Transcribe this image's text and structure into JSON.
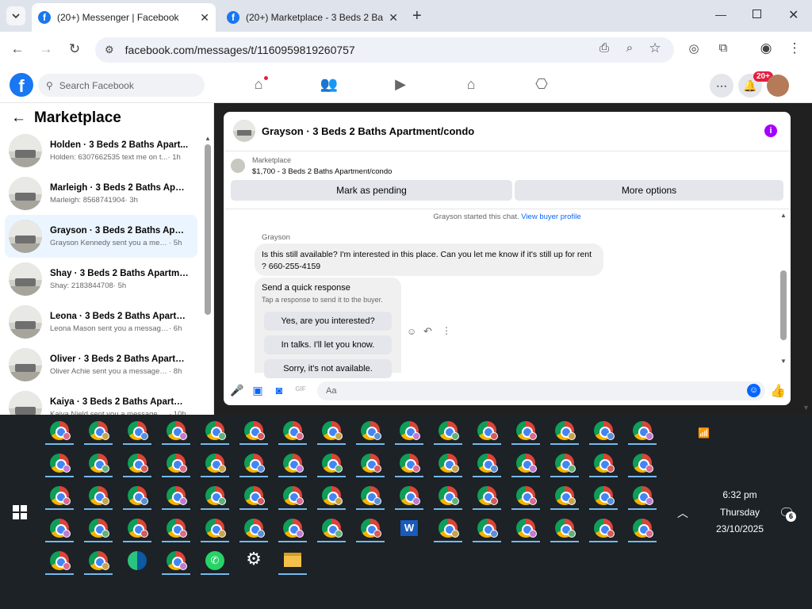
{
  "tabs": [
    {
      "title": "(20+) Messenger | Facebook"
    },
    {
      "title": "(20+) Marketplace - 3 Beds 2 Ba"
    }
  ],
  "address": {
    "url": "facebook.com/messages/t/1160959819260757"
  },
  "fb": {
    "search_placeholder": "Search Facebook",
    "notif_badge": "20+"
  },
  "sidebar": {
    "title": "Marketplace",
    "items": [
      {
        "name": "Holden · 3 Beds 2 Baths Apart...",
        "preview": "Holden: 6307662535 text me on t...",
        "time": " · 1h"
      },
      {
        "name": "Marleigh · 3 Beds 2 Baths Apart...",
        "preview": "Marleigh: 8568741904",
        "time": " · 3h"
      },
      {
        "name": "Grayson · 3 Beds 2 Baths Apart...",
        "preview": "Grayson Kennedy sent you a mess...",
        "time": " · 5h"
      },
      {
        "name": "Shay · 3 Beds 2 Baths Apartmen...",
        "preview": "Shay: 2183844708",
        "time": " · 5h"
      },
      {
        "name": "Leona · 3 Beds 2 Baths Apartme...",
        "preview": "Leona Mason sent you a message ...",
        "time": " · 6h"
      },
      {
        "name": "Oliver · 3 Beds 2 Baths Apartme...",
        "preview": "Oliver Achie sent you a message a...",
        "time": " · 8h"
      },
      {
        "name": "Kaiya · 3 Beds 2 Baths Apartme...",
        "preview": "Kaiya Nield sent you a message a...",
        "time": " · 10h"
      }
    ]
  },
  "chat": {
    "title": "Grayson · 3 Beds 2 Baths Apartment/condo",
    "listing_label": "Marketplace",
    "listing_text": "$1,700 - 3 Beds 2 Baths Apartment/condo",
    "mark_pending": "Mark as pending",
    "more_options": "More options",
    "system_msg": "Grayson started this chat.",
    "view_profile": "View buyer profile",
    "sender": "Grayson",
    "message": "Is this still available? I'm interested in this place. Can you let me know if it's still up for rent ? 660-255-4159",
    "quick_title": "Send a quick response",
    "quick_sub": "Tap a response to send it to the buyer.",
    "quick_responses": [
      "Yes, are you interested?",
      "In talks. I'll let you know.",
      "Sorry, it's not available."
    ],
    "composer_placeholder": "Aa"
  },
  "taskbar": {
    "time": "6:32 pm",
    "day": "Thursday",
    "date": "23/10/2025",
    "notif_count": "6"
  },
  "colors": {
    "accent": "#0866ff",
    "fb_blue": "#1877f2",
    "selected_row": "#ebf5ff",
    "taskbar_bg": "#1c2226"
  }
}
